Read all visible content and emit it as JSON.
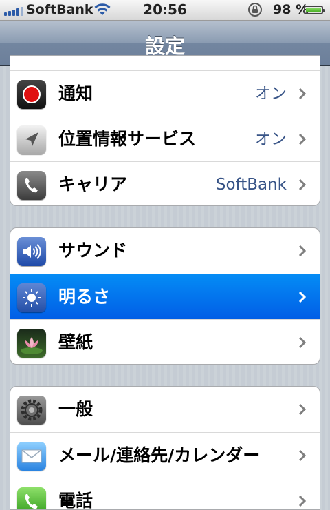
{
  "status_bar": {
    "carrier": "SoftBank",
    "time": "20:56",
    "battery_percent": "98 %",
    "battery_level": 0.98,
    "icons": [
      "signal-bars-icon",
      "wifi-icon",
      "rotation-lock-icon",
      "battery-icon"
    ]
  },
  "nav": {
    "title": "設定"
  },
  "groups": [
    {
      "rows": [
        {
          "label": "通知",
          "value": "オン",
          "icon": "notifications-icon"
        },
        {
          "label": "位置情報サービス",
          "value": "オン",
          "icon": "location-arrow-icon"
        },
        {
          "label": "キャリア",
          "value": "SoftBank",
          "icon": "phone-handset-icon"
        }
      ]
    },
    {
      "rows": [
        {
          "label": "サウンド",
          "value": "",
          "icon": "speaker-icon"
        },
        {
          "label": "明るさ",
          "value": "",
          "icon": "brightness-sun-icon",
          "selected": true
        },
        {
          "label": "壁紙",
          "value": "",
          "icon": "wallpaper-flower-icon"
        }
      ]
    },
    {
      "rows": [
        {
          "label": "一般",
          "value": "",
          "icon": "gear-icon"
        },
        {
          "label": "メール/連絡先/カレンダー",
          "value": "",
          "icon": "mail-envelope-icon"
        },
        {
          "label": "電話",
          "value": "",
          "icon": "phone-app-icon"
        }
      ]
    }
  ],
  "colors": {
    "selection": "#015ee6",
    "value_text": "#385487",
    "navbar": "#6c7f9a"
  }
}
